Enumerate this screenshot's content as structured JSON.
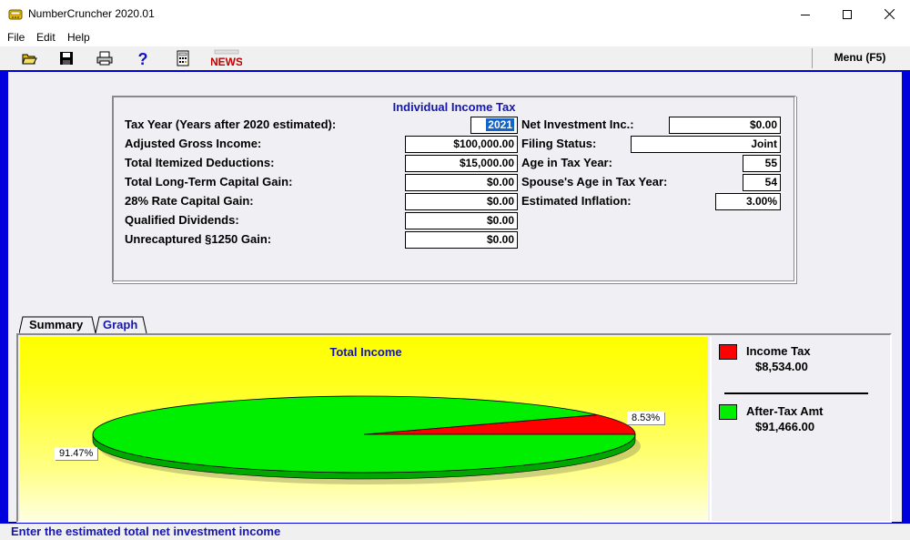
{
  "window": {
    "title": "NumberCruncher 2020.01"
  },
  "menubar": {
    "items": [
      "File",
      "Edit",
      "Help"
    ]
  },
  "toolbar": {
    "buttons": [
      "open-icon",
      "save-icon",
      "print-icon",
      "help-icon",
      "calculator-icon",
      "news-icon"
    ],
    "news_label": "NEWS",
    "menu_label": "Menu (F5)"
  },
  "panel": {
    "title": "Individual Income Tax",
    "left": [
      {
        "label": "Tax Year (Years after 2020 estimated):",
        "value": "2021"
      },
      {
        "label": "Adjusted Gross Income:",
        "value": "$100,000.00"
      },
      {
        "label": "Total Itemized Deductions:",
        "value": "$15,000.00"
      },
      {
        "label": "Total Long-Term Capital Gain:",
        "value": "$0.00"
      },
      {
        "label": "28% Rate Capital Gain:",
        "value": "$0.00"
      },
      {
        "label": "Qualified Dividends:",
        "value": "$0.00"
      },
      {
        "label": "Unrecaptured §1250 Gain:",
        "value": "$0.00"
      }
    ],
    "right": [
      {
        "label": "Net Investment Inc.:",
        "value": "$0.00"
      },
      {
        "label": "Filing Status:",
        "value": "Joint"
      },
      {
        "label": "Age in Tax Year:",
        "value": "55"
      },
      {
        "label": "Spouse's Age in Tax Year:",
        "value": "54"
      },
      {
        "label": "Estimated Inflation:",
        "value": "3.00%"
      }
    ]
  },
  "tabs": [
    {
      "label": "Summary",
      "active": true
    },
    {
      "label": "Graph",
      "active": false
    }
  ],
  "chart_data": {
    "type": "pie",
    "title": "Total Income",
    "slices": [
      {
        "name": "Income Tax",
        "value": 8534.0,
        "percent": 8.53,
        "color": "#ff0000",
        "percent_label": "8.53%",
        "value_label": "$8,534.00"
      },
      {
        "name": "After-Tax Amt",
        "value": 91466.0,
        "percent": 91.47,
        "color": "#00ee00",
        "percent_label": "91.47%",
        "value_label": "$91,466.00"
      }
    ]
  },
  "status": {
    "text": "Enter the estimated total net investment income"
  },
  "colors": {
    "frame": "#0000dd",
    "accent_text": "#1515b0",
    "tax": "#ff0000",
    "after_tax": "#00ee00"
  }
}
